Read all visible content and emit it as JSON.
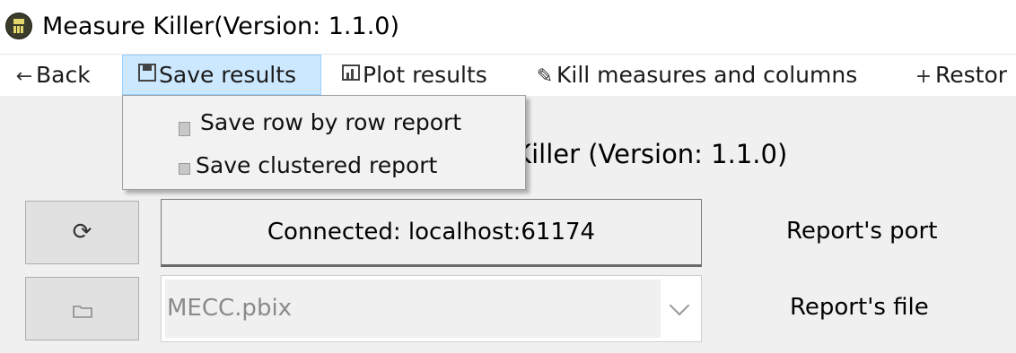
{
  "window": {
    "title": "Measure Killer(Version: 1.1.0)",
    "icon": "calculator-icon"
  },
  "menu": {
    "back": {
      "icon": "←",
      "label": "Back"
    },
    "save": {
      "icon": "💾",
      "label": "Save results"
    },
    "plot": {
      "icon": "📊",
      "label": "Plot results"
    },
    "kill": {
      "icon": "✎",
      "label": "Kill measures and columns"
    },
    "restore": {
      "icon": "+",
      "label": "Restor"
    }
  },
  "dropdown": {
    "items": [
      {
        "label": "Save row by row report"
      },
      {
        "label": "Save clustered report"
      }
    ]
  },
  "main": {
    "heading": "e Killer (Version: 1.1.0)",
    "refresh_icon": "⟳",
    "connection_status": "Connected: localhost:61174",
    "port_label": "Report's port",
    "folder_icon": "folder-icon",
    "file_value": "MECC.pbix",
    "file_label": "Report's file"
  },
  "colors": {
    "menu_active_bg": "#cce8ff",
    "menu_active_border": "#99d1ff",
    "window_bg": "#f0f0f0"
  }
}
